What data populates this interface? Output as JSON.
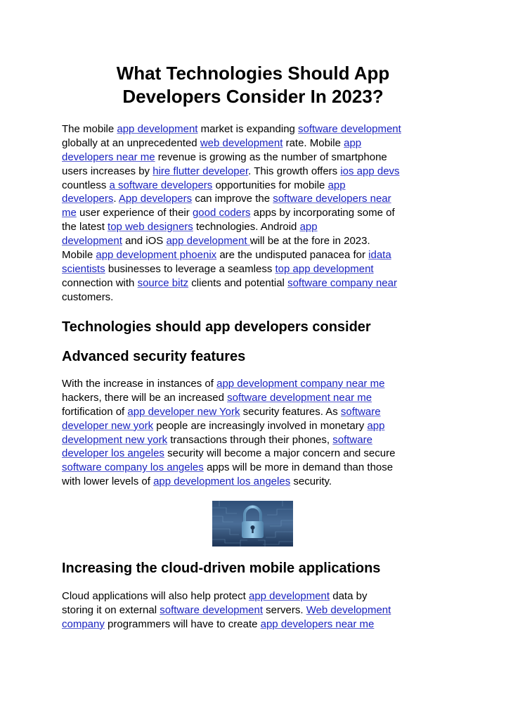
{
  "document": {
    "title_lines": [
      "What Technologies Should App",
      "Developers Consider In 2023?"
    ],
    "intro": [
      [
        {
          "t": "The mobile "
        },
        {
          "l": "app development"
        },
        {
          "t": " market is expanding "
        },
        {
          "l": "software development"
        }
      ],
      [
        {
          "t": "globally at an unprecedented "
        },
        {
          "l": "web development"
        },
        {
          "t": " rate. Mobile "
        },
        {
          "l": "app"
        }
      ],
      [
        {
          "l": "developers near me"
        },
        {
          "t": " revenue is growing as the number of smartphone"
        }
      ],
      [
        {
          "t": "users increases by "
        },
        {
          "l": "hire flutter developer"
        },
        {
          "t": ". This growth offers "
        },
        {
          "l": "ios app devs"
        }
      ],
      [
        {
          "t": "countless "
        },
        {
          "l": "a software developers"
        },
        {
          "t": " opportunities for mobile "
        },
        {
          "l": "app"
        }
      ],
      [
        {
          "l": "developers"
        },
        {
          "t": ". "
        },
        {
          "l": "App developers"
        },
        {
          "t": " can improve the "
        },
        {
          "l": "software developers near"
        }
      ],
      [
        {
          "l": "me"
        },
        {
          "t": " user experience of their "
        },
        {
          "l": "good coders"
        },
        {
          "t": " apps by incorporating some of"
        }
      ],
      [
        {
          "t": "the latest "
        },
        {
          "l": "top web designers"
        },
        {
          "t": " technologies. Android "
        },
        {
          "l": "app"
        }
      ],
      [
        {
          "l": "development"
        },
        {
          "t": " and iOS "
        },
        {
          "l": "app development "
        },
        {
          "t": "will be at the fore in 2023."
        }
      ],
      [
        {
          "t": "Mobile "
        },
        {
          "l": "app development phoenix"
        },
        {
          "t": " are the undisputed panacea for "
        },
        {
          "l": "idata"
        }
      ],
      [
        {
          "l": "scientists"
        },
        {
          "t": " businesses to leverage a seamless "
        },
        {
          "l": "top app development"
        }
      ],
      [
        {
          "t": "connection with "
        },
        {
          "l": "source bitz"
        },
        {
          "t": " clients and potential "
        },
        {
          "l": "software company near"
        }
      ],
      [
        {
          "t": "customers."
        }
      ]
    ],
    "heading_1": "Technologies should app developers consider",
    "heading_2": "Advanced security features",
    "security": [
      [
        {
          "t": "With the increase in instances of "
        },
        {
          "l": "app development company near me"
        }
      ],
      [
        {
          "t": "hackers, there will be an increased "
        },
        {
          "l": "software development near me"
        }
      ],
      [
        {
          "t": "fortification of "
        },
        {
          "l": "app developer new York"
        },
        {
          "t": " security features. As "
        },
        {
          "l": "software"
        }
      ],
      [
        {
          "l": "developer new york"
        },
        {
          "t": " people are increasingly involved in monetary "
        },
        {
          "l": "app"
        }
      ],
      [
        {
          "l": "development new york"
        },
        {
          "t": " transactions through their phones, "
        },
        {
          "l": "software"
        }
      ],
      [
        {
          "l": "developer los angeles"
        },
        {
          "t": " security will become a major concern and secure"
        }
      ],
      [
        {
          "l": "software company los angeles"
        },
        {
          "t": " apps will be more in demand than those"
        }
      ],
      [
        {
          "t": "with lower levels of "
        },
        {
          "l": "app development los angeles"
        },
        {
          "t": " security."
        }
      ]
    ],
    "image": {
      "icon": "padlock-circuit-icon",
      "alt": "padlock on circuit board"
    },
    "heading_3": "Increasing the cloud-driven mobile applications",
    "cloud": [
      [
        {
          "t": "Cloud applications will also help protect "
        },
        {
          "l": "app development"
        },
        {
          "t": " data by"
        }
      ],
      [
        {
          "t": "storing it on external "
        },
        {
          "l": "software development"
        },
        {
          "t": " servers. "
        },
        {
          "l": "Web development"
        }
      ],
      [
        {
          "l": "company"
        },
        {
          "t": " programmers will have to create "
        },
        {
          "l": "app developers near me"
        }
      ]
    ],
    "colors": {
      "link": "#1a23c0",
      "text": "#000000",
      "background": "#ffffff"
    }
  }
}
